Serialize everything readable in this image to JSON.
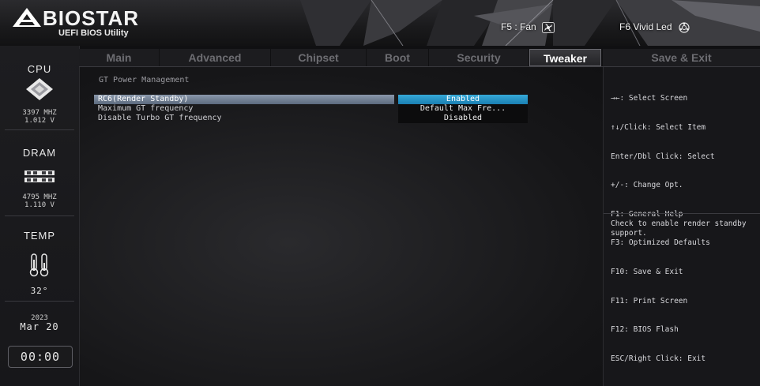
{
  "header": {
    "brand": "BIOSTAR",
    "subtitle": "UEFI BIOS Utility",
    "f5_label": "F5 : Fan",
    "f6_label": "F6  Vivid Led",
    "f5_icon": "fan-icon",
    "f6_icon": "led-icon"
  },
  "left": {
    "cpu": {
      "title": "CPU",
      "freq": "3397 MHZ",
      "volt": "1.012 V",
      "icon": "cpu-chip-icon"
    },
    "dram": {
      "title": "DRAM",
      "freq": "4795 MHZ",
      "volt": "1.110 V",
      "icon": "dram-module-icon"
    },
    "temp": {
      "title": "TEMP",
      "value": "32°",
      "icon": "thermometer-icon"
    },
    "date": {
      "year": "2023",
      "day": "Mar 20"
    },
    "clock": "00:00"
  },
  "tabs": [
    "Main",
    "Advanced",
    "Chipset",
    "Boot",
    "Security",
    "Tweaker"
  ],
  "active_tab": "Tweaker",
  "save_exit_tab": "Save & Exit",
  "main": {
    "section_title": "GT Power Management",
    "rows": [
      {
        "label": "RC6(Render Standby)",
        "value": "Enabled"
      },
      {
        "label": "Maximum GT frequency",
        "value": "Default Max Fre..."
      },
      {
        "label": "Disable Turbo GT frequency",
        "value": "Disabled"
      }
    ]
  },
  "right": {
    "keys": [
      "→←: Select Screen",
      "↑↓/Click: Select Item",
      "Enter/Dbl Click: Select",
      "+/-: Change Opt.",
      "F1: General Help",
      "F3: Optimized Defaults",
      "F10: Save & Exit",
      "F11: Print Screen",
      "F12: BIOS Flash",
      "ESC/Right Click: Exit"
    ],
    "help": "Check to enable render standby support."
  },
  "colors": {
    "accent_selected_value": "#1b7fb2",
    "selected_row": "#7383997",
    "background": "#101012"
  }
}
